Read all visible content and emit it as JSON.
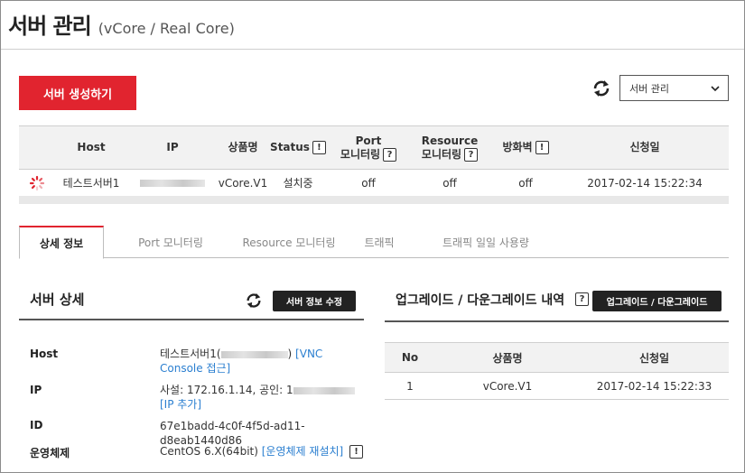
{
  "header": {
    "title": "서버 관리",
    "subtitle": "(vCore / Real Core)"
  },
  "toolbar": {
    "create_label": "서버 생성하기",
    "select_value": "서버 관리",
    "refresh_icon": "refresh-icon",
    "chevron_icon": "chevron-down-icon"
  },
  "server_table": {
    "headers": {
      "host": "Host",
      "ip": "IP",
      "product": "상품명",
      "status": "Status",
      "port_1": "Port",
      "port_2": "모니터링",
      "resource_1": "Resource",
      "resource_2": "모니터링",
      "firewall": "방화벽",
      "date": "신청일"
    },
    "help_glyph_info": "!",
    "help_glyph_q": "?",
    "rows": [
      {
        "host": "테스트서버1",
        "ip": "",
        "product": "vCore.V1",
        "status": "설치중",
        "port_monitoring": "off",
        "resource_monitoring": "off",
        "firewall": "off",
        "date": "2017-02-14 15:22:34"
      }
    ]
  },
  "tabs": [
    {
      "label": "상세 정보",
      "active": true
    },
    {
      "label": "Port 모니터링",
      "active": false
    },
    {
      "label": "Resource 모니터링",
      "active": false
    },
    {
      "label": "트래픽",
      "active": false
    },
    {
      "label": "트래픽 일일 사용량",
      "active": false
    }
  ],
  "detail": {
    "title": "서버 상세",
    "edit_label": "서버 정보 수정",
    "rows": [
      {
        "label": "Host",
        "value_prefix": "테스트서버1(",
        "value_suffix": ")",
        "link": "[VNC Console 접근]"
      },
      {
        "label": "IP",
        "value_prefix": "사설: 172.16.1.14, 공인: 1",
        "value_suffix": "",
        "link": "[IP 추가]"
      },
      {
        "label": "ID",
        "value": "67e1badd-4c0f-4f5d-ad11-d8eab1440d86"
      },
      {
        "label": "운영체제",
        "value": "CentOS 6.X(64bit)",
        "link": "[운영체제 재설치]"
      }
    ]
  },
  "upgrade": {
    "title": "업그레이드 / 다운그레이드 내역",
    "help": "?",
    "button_label": "업그레이드 / 다운그레이드",
    "headers": {
      "no": "No",
      "product": "상품명",
      "date": "신청일"
    },
    "rows": [
      {
        "no": "1",
        "product": "vCore.V1",
        "date": "2017-02-14 15:22:33"
      }
    ]
  },
  "colors": {
    "accent": "#e1242f",
    "link": "#2b7fd0",
    "dark_button": "#222222"
  }
}
